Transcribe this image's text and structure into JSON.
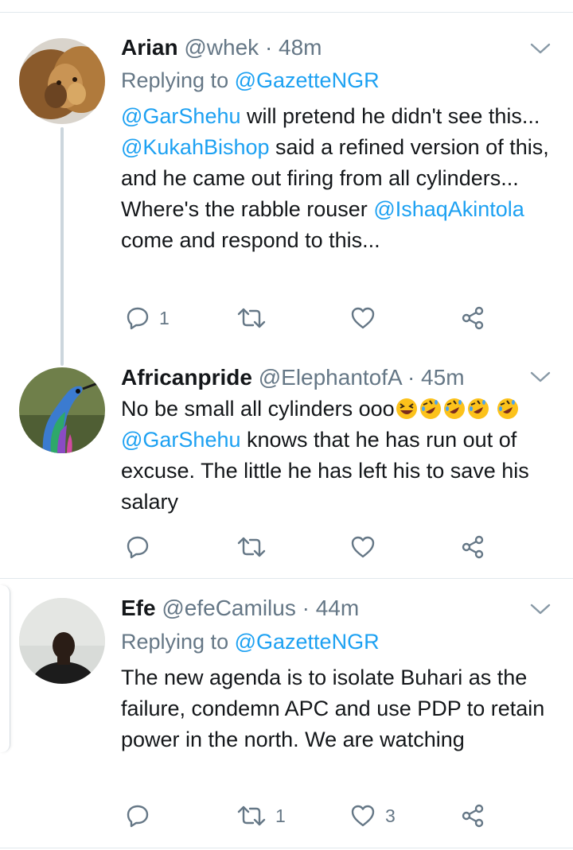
{
  "tweets": [
    {
      "name": "Arian",
      "handle": "@whek",
      "time": "· 48m",
      "replying_prefix": "Replying to",
      "replying_handle": "@GazetteNGR",
      "text": {
        "m1": "@GarShehu",
        "t1": " will pretend he didn't see this... ",
        "m2": "@KukahBishop",
        "t2": " said a refined version of this, and he came out firing from all cylinders... Where's the rabble rouser ",
        "m3": "@IshaqAkintola",
        "t3": " come and respond to this..."
      },
      "reply_count": "1",
      "retweet_count": "",
      "like_count": ""
    },
    {
      "name": "Africanpride",
      "handle": "@ElephantofA",
      "time": "· 45m",
      "text": {
        "t1": "No be small all cylinders ooo",
        "m1": "@GarShehu",
        "t2": " knows that he has run out of excuse. The little he has left his to save his salary"
      },
      "emojis": [
        "grinning-squinting-face",
        "rolling-on-floor-laughing",
        "rolling-on-floor-laughing",
        "rolling-on-floor-laughing",
        "rolling-on-floor-laughing"
      ],
      "reply_count": "",
      "retweet_count": "",
      "like_count": ""
    },
    {
      "name": "Efe",
      "handle": "@efeCamilus",
      "time": "· 44m",
      "replying_prefix": "Replying to",
      "replying_handle": "@GazetteNGR",
      "text": {
        "t1": "The new agenda is to isolate Buhari as the failure, condemn APC and use PDP to retain power in the north. We are watching"
      },
      "reply_count": "",
      "retweet_count": "1",
      "like_count": "3"
    }
  ],
  "icons": {
    "reply": "reply-icon",
    "retweet": "retweet-icon",
    "like": "heart-icon",
    "share": "share-icon",
    "more": "chevron-down-icon"
  },
  "colors": {
    "link": "#1da1f2",
    "muted": "#657786",
    "text": "#14171a",
    "separator": "#e1e8ed"
  }
}
